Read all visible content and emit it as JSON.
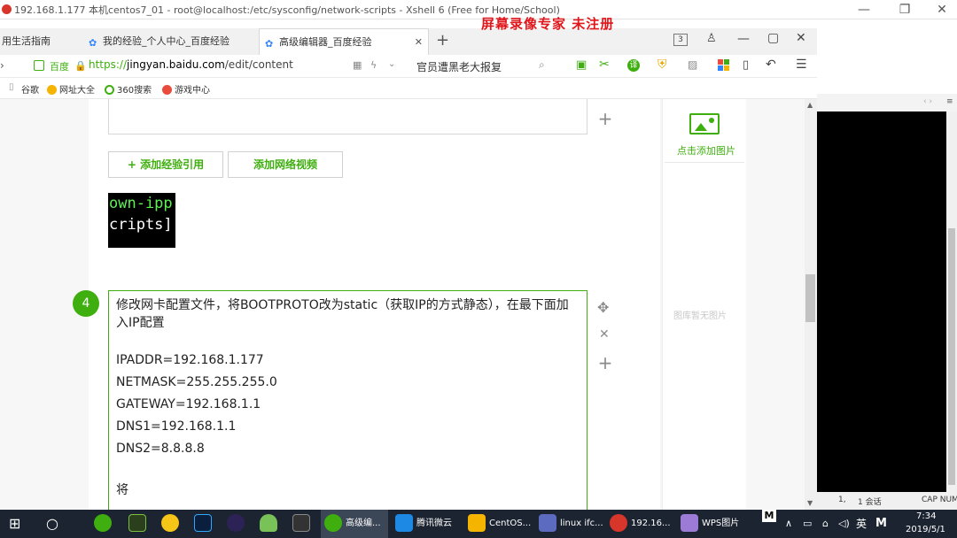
{
  "xshell": {
    "title": "192.168.1.177 本机centos7_01 - root@localhost:/etc/sysconfig/network-scripts - Xshell 6 (Free for Home/School)",
    "recorder_watermark": "屏幕录像专家  未注册"
  },
  "browser": {
    "tabs": [
      {
        "label": "用生活指南"
      },
      {
        "label": "我的经验_个人中心_百度经验"
      },
      {
        "label": "高级编辑器_百度经验"
      }
    ],
    "tab_count": "3",
    "site_name": "百度",
    "url_prefix": "https://",
    "url_host": "jingyan.baidu.com",
    "url_path": "/edit/content",
    "search_text": "官员遭黑老大报复",
    "bookmarks": [
      {
        "label": "谷歌"
      },
      {
        "label": "网址大全"
      },
      {
        "label": "360搜索"
      },
      {
        "label": "游戏中心"
      }
    ]
  },
  "editor": {
    "add_reference_label": "+ 添加经验引用",
    "add_video_label": "添加网络视频",
    "thumb_lines": [
      "own-ipp",
      "cripts]"
    ],
    "step_number": "4",
    "step_text": "修改网卡配置文件，将BOOTPROTO改为static（获取IP的方式静态），在最下面加入IP配置",
    "config_lines": [
      "IPADDR=192.168.1.177",
      "NETMASK=255.255.255.0",
      "GATEWAY=192.168.1.1",
      "DNS1=192.168.1.1",
      "DNS2=8.8.8.8"
    ],
    "trailing_text": "将"
  },
  "sidebar": {
    "add_image_label": "点击添加图片",
    "empty_gallery_label": "图库暂无图片"
  },
  "xshell_status": {
    "pos": "1,",
    "sessions": "1 会话",
    "caps": "CAP NUM"
  },
  "taskbar": {
    "items": [
      {
        "label": "高级编..."
      },
      {
        "label": "腾讯微云"
      },
      {
        "label": "CentOS..."
      },
      {
        "label": "linux ifc..."
      },
      {
        "label": "192.16..."
      },
      {
        "label": "WPS图片"
      }
    ],
    "ime": "英",
    "time": "7:34",
    "date": "2019/5/1"
  },
  "colors": {
    "accent_green": "#3eaf0e",
    "watermark_red": "#e0161b",
    "taskbar_bg": "#1c2431"
  }
}
